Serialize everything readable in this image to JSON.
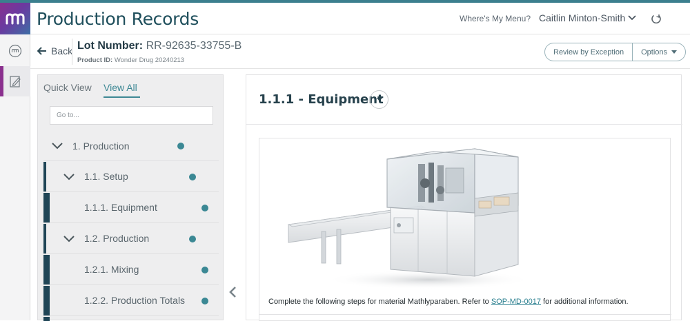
{
  "app": {
    "title": "Production Records",
    "menu_link": "Where's My Menu?",
    "user_name": "Caitlin Minton-Smith"
  },
  "subheader": {
    "back_label": "Back",
    "lot_label": "Lot Number:",
    "lot_value": "RR-92635-33755-B",
    "product_label": "Product ID:",
    "product_value": "Wonder Drug 20240213",
    "review_button": "Review by Exception",
    "options_button": "Options"
  },
  "sidebar": {
    "tabs": [
      "Quick View",
      "View All"
    ],
    "active_tab": "View All",
    "goto_placeholder": "Go to...",
    "tree": [
      {
        "label": "1.  Production",
        "level": 0
      },
      {
        "label": "1.1.  Setup",
        "level": 1
      },
      {
        "label": "1.1.1.  Equipment",
        "level": 2
      },
      {
        "label": "1.2.  Production",
        "level": 1
      },
      {
        "label": "1.2.1.  Mixing",
        "level": 2
      },
      {
        "label": "1.2.2.  Production Totals",
        "level": 2
      }
    ]
  },
  "content": {
    "step_title": "1.1.1 - Equipment",
    "instruction_text": "Complete the following steps for material Mathlyparaben. Refer to",
    "instruction_link": "SOP-MD-0017",
    "instruction_suffix": "for additional information."
  },
  "colors": {
    "brand_teal": "#3b8894",
    "brand_purple": "#8a2f8e",
    "tree_bar": "#1f4556"
  },
  "icons": [
    "logo-icon",
    "power-icon",
    "chevron-down-icon",
    "back-arrow-icon",
    "module-icon",
    "edit-record-icon",
    "collapse-left-icon",
    "status-dot-icon"
  ]
}
